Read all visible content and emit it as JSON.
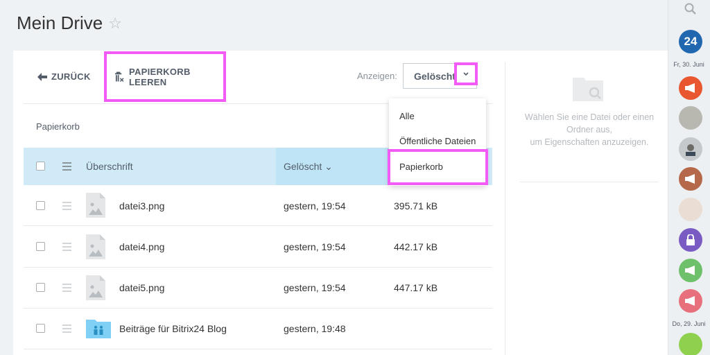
{
  "page": {
    "title": "Mein Drive",
    "star": "☆"
  },
  "toolbar": {
    "back_label": "ZURÜCK",
    "empty_trash_label": "PAPIERKORB LEEREN",
    "show_label": "Anzeigen:",
    "show_value": "Gelöscht"
  },
  "breadcrumb": "Papierkorb",
  "table": {
    "headers": {
      "title": "Überschrift",
      "deleted": "Gelöscht ⌄"
    },
    "rows": [
      {
        "name": "datei3.png",
        "date": "gestern, 19:54",
        "size": "395.71 kB",
        "type": "image"
      },
      {
        "name": "datei4.png",
        "date": "gestern, 19:54",
        "size": "442.17 kB",
        "type": "image"
      },
      {
        "name": "datei5.png",
        "date": "gestern, 19:54",
        "size": "447.17 kB",
        "type": "image"
      },
      {
        "name": "Beiträge für Bitrix24 Blog",
        "date": "gestern, 19:48",
        "size": "",
        "type": "folder"
      }
    ]
  },
  "dropdown": {
    "options": [
      "Alle",
      "Öffentliche Dateien",
      "Papierkorb"
    ]
  },
  "sidepanel": {
    "lines": [
      "Wählen Sie eine Datei oder einen",
      "Ordner aus,",
      "um Eigenschaften anzuzeigen."
    ]
  },
  "rightbar": {
    "logo": "24",
    "date1": "Fr, 30. Juni",
    "date2": "Do, 29. Juni"
  },
  "colors": {
    "highlight": "#f25bf5",
    "header_bg": "#d0ebf7",
    "brand": "#2067b0"
  }
}
